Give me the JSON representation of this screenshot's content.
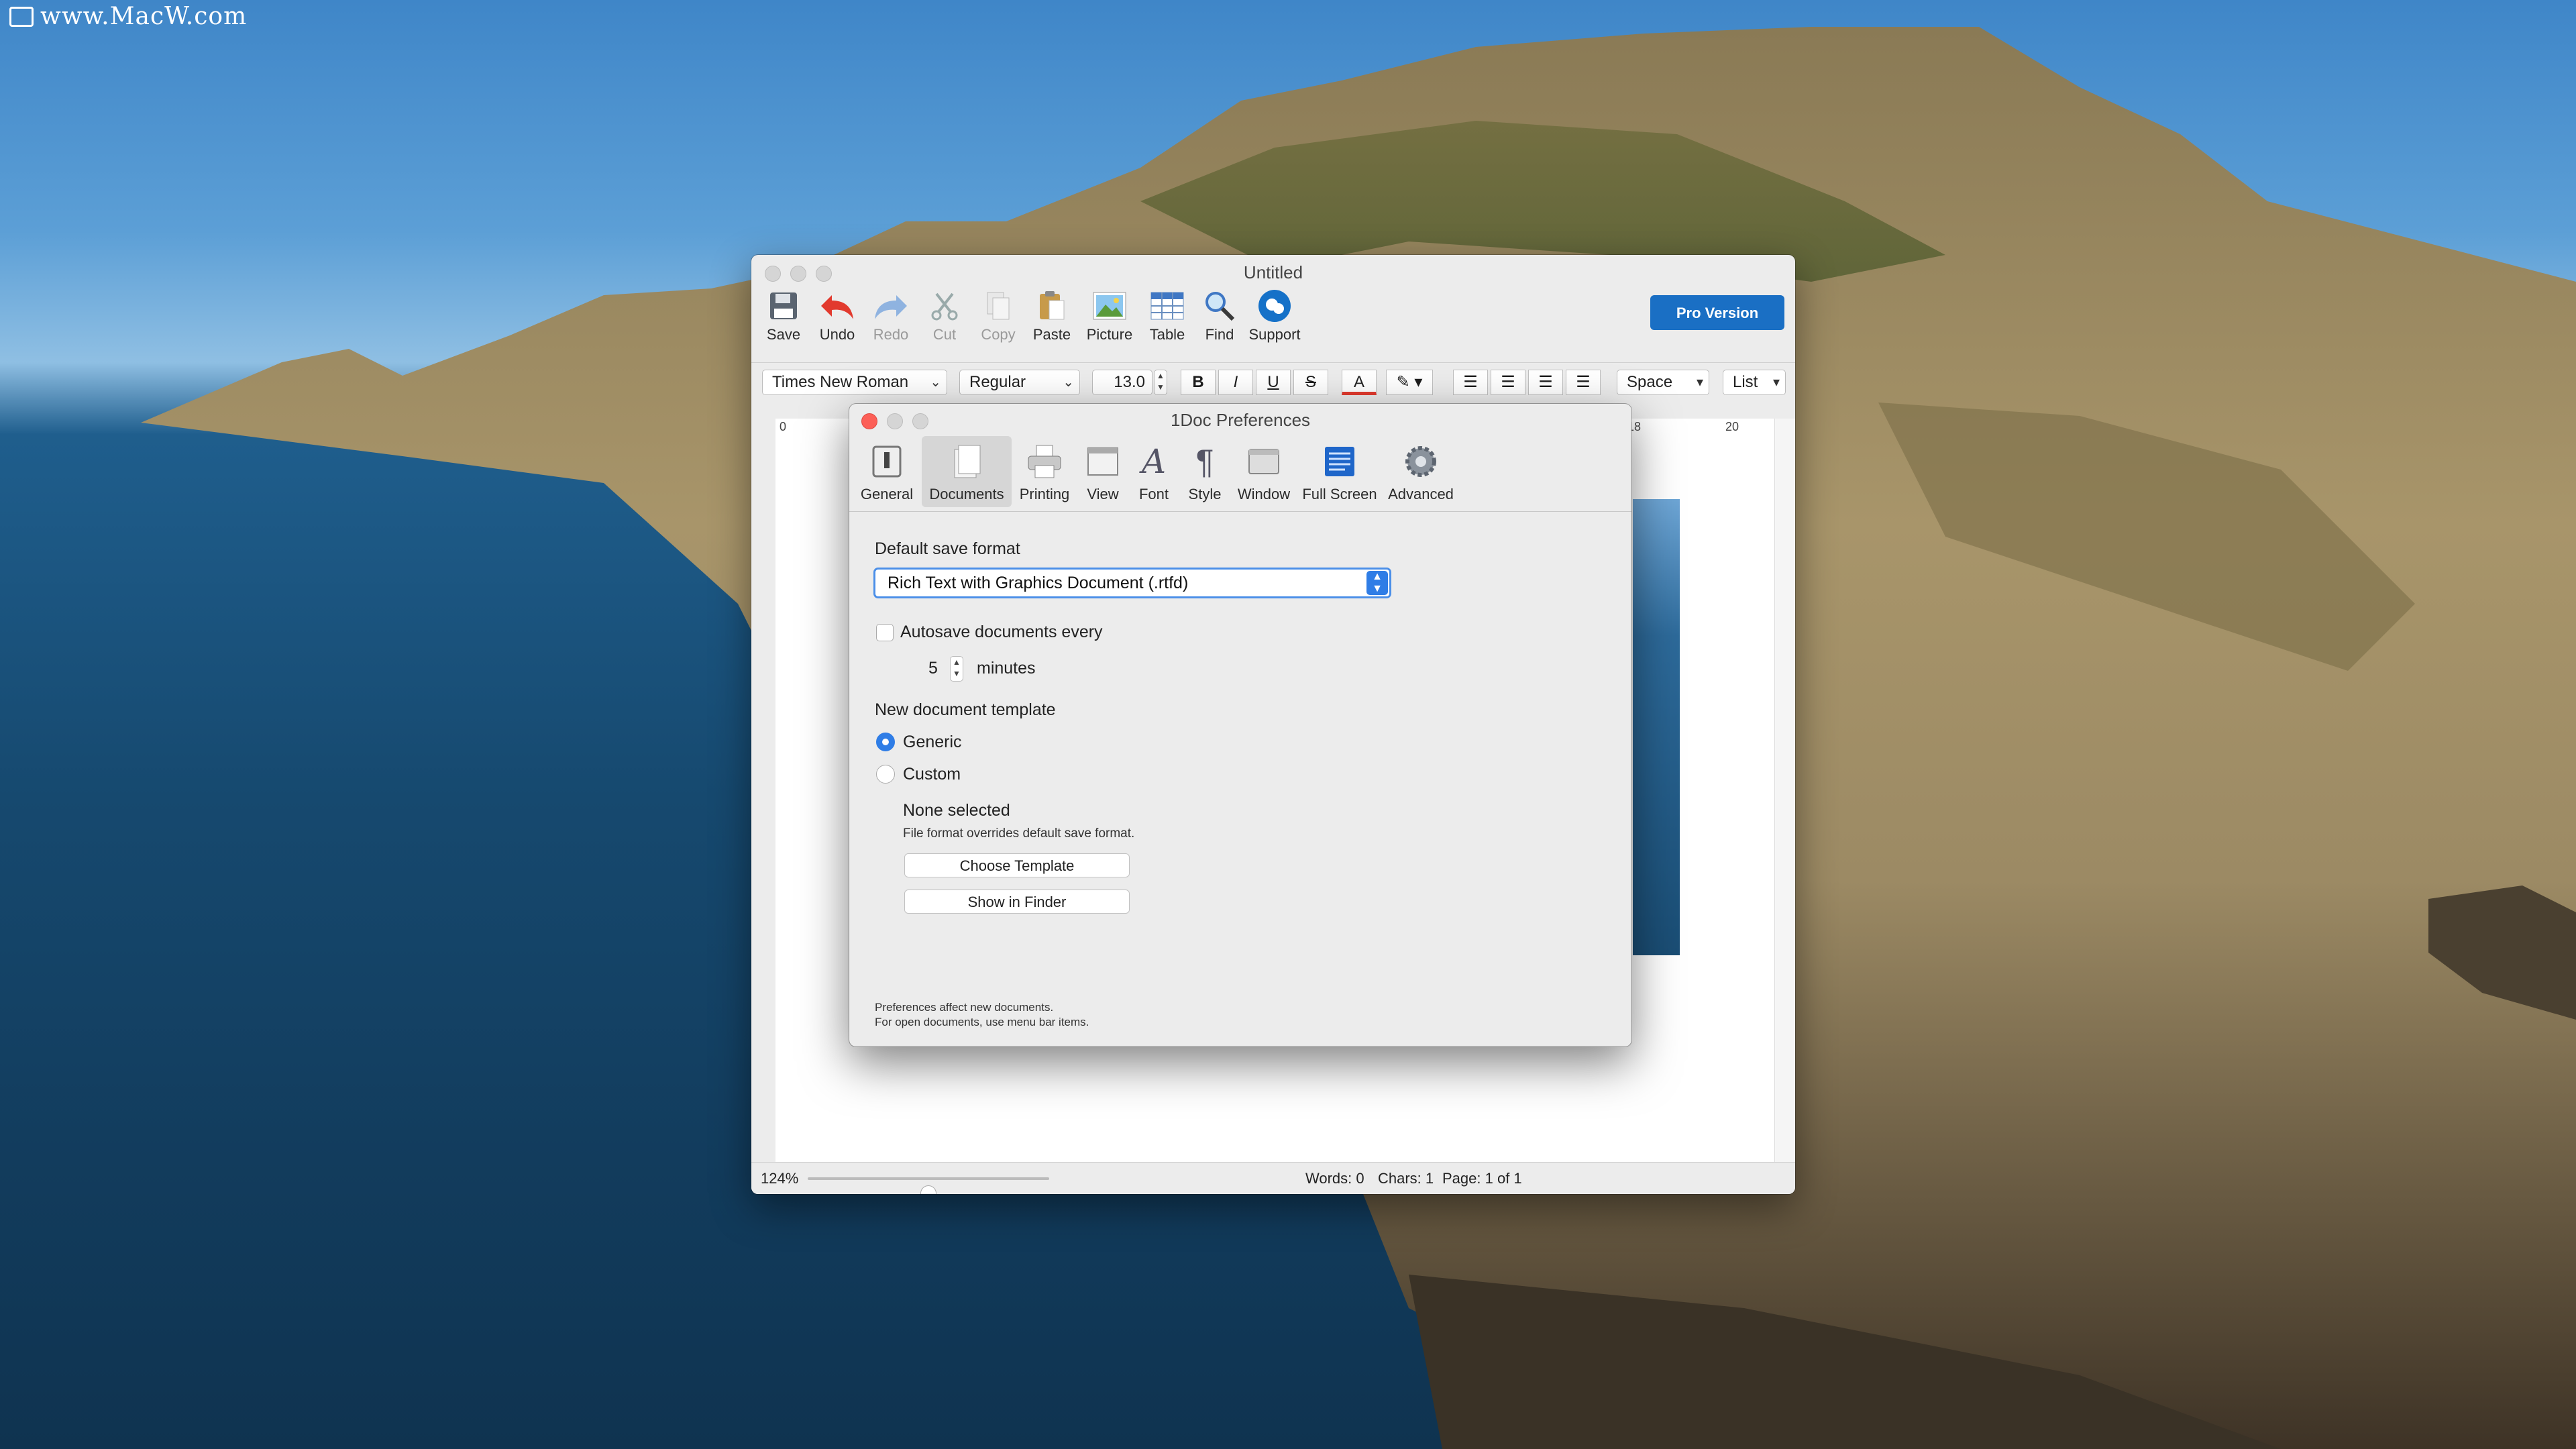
{
  "watermark": {
    "text": "www.MacW.com"
  },
  "main_window": {
    "title": "Untitled",
    "toolbar": {
      "save": "Save",
      "undo": "Undo",
      "redo": "Redo",
      "cut": "Cut",
      "copy": "Copy",
      "paste": "Paste",
      "picture": "Picture",
      "table": "Table",
      "find": "Find",
      "support": "Support"
    },
    "pro_button": "Pro Version",
    "format": {
      "font": "Times New Roman",
      "style": "Regular",
      "size": "13.0",
      "bold": "B",
      "italic": "I",
      "underline": "U",
      "strike": "S",
      "color_a": "A",
      "spacing": "Space",
      "list": "List"
    },
    "ruler": {
      "marks": [
        "0",
        "18",
        "20"
      ]
    },
    "status": {
      "zoom": "124%",
      "words": "Words: 0",
      "chars": "Chars: 1",
      "page": "Page: 1 of 1"
    },
    "zoom_level": 0.5
  },
  "prefs": {
    "title": "1Doc Preferences",
    "tabs": [
      "General",
      "Documents",
      "Printing",
      "View",
      "Font",
      "Style",
      "Window",
      "Full Screen",
      "Advanced"
    ],
    "selected_tab": "Documents",
    "default_save_format_label": "Default save format",
    "default_save_format_value": "Rich Text with Graphics Document (.rtfd)",
    "autosave_label": "Autosave documents every",
    "autosave_checked": false,
    "autosave_minutes": "5",
    "minutes_label": "minutes",
    "template_label": "New document template",
    "generic_label": "Generic",
    "custom_label": "Custom",
    "none_selected": "None selected",
    "override_note": "File format overrides default save format.",
    "choose_template": "Choose Template",
    "show_in_finder": "Show in Finder",
    "footer_line1": "Preferences affect new documents.",
    "footer_line2": "For open documents, use menu bar items."
  },
  "colors": {
    "accent": "#2f7de6",
    "pro": "#1a6fc4",
    "close": "#fc5f57"
  }
}
